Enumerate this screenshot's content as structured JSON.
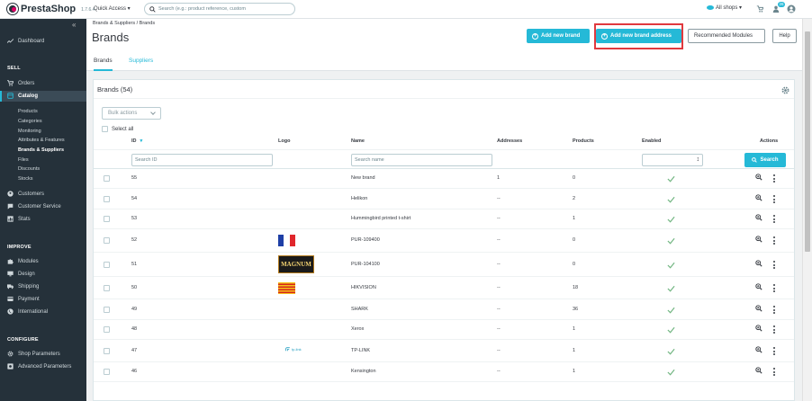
{
  "app": {
    "brand": "PrestaShop",
    "version": "1.7.6.4"
  },
  "topbar": {
    "quick_access": "Quick Access ▾",
    "search_placeholder": "Search (e.g.: product reference, custom",
    "all_shops": "All shops ▾",
    "badge_cart": "",
    "badge_users": "26"
  },
  "sidebar": {
    "dashboard": "Dashboard",
    "sell": "SELL",
    "orders": "Orders",
    "catalog": "Catalog",
    "catalog_items": [
      "Products",
      "Categories",
      "Monitoring",
      "Attributes & Features",
      "Brands & Suppliers",
      "Files",
      "Discounts",
      "Stocks"
    ],
    "customers": "Customers",
    "customer_service": "Customer Service",
    "stats": "Stats",
    "improve": "IMPROVE",
    "modules": "Modules",
    "design": "Design",
    "shipping": "Shipping",
    "payment": "Payment",
    "international": "International",
    "configure": "CONFIGURE",
    "shop_parameters": "Shop Parameters",
    "advanced_parameters": "Advanced Parameters"
  },
  "header": {
    "breadcrumb": "Brands & Suppliers  /  Brands",
    "title": "Brands",
    "add_brand": "Add new brand",
    "add_brand_address": "Add new brand address",
    "recommended_modules": "Recommended Modules",
    "help": "Help",
    "tabs": [
      "Brands",
      "Suppliers"
    ]
  },
  "panel": {
    "title": "Brands (54)",
    "bulk_actions": "Bulk actions",
    "select_all": "Select all",
    "columns": {
      "id": "ID",
      "logo": "Logo",
      "name": "Name",
      "addresses": "Addresses",
      "products": "Products",
      "enabled": "Enabled",
      "actions": "Actions"
    },
    "search_id_placeholder": "Search ID",
    "search_name_placeholder": "Search name",
    "search_button": "Search",
    "rows": [
      {
        "id": "55",
        "name": "New brand",
        "addresses": "1",
        "products": "0"
      },
      {
        "id": "54",
        "name": "Helikon",
        "addresses": "--",
        "products": "2"
      },
      {
        "id": "53",
        "name": "Hummingbird printed t-shirt",
        "addresses": "--",
        "products": "1"
      },
      {
        "id": "52",
        "name": "PUR-109400",
        "addresses": "--",
        "products": "0"
      },
      {
        "id": "51",
        "name": "PUR-104100",
        "addresses": "--",
        "products": "0"
      },
      {
        "id": "50",
        "name": "HIKVISION",
        "addresses": "--",
        "products": "18"
      },
      {
        "id": "49",
        "name": "SHARK",
        "addresses": "--",
        "products": "36"
      },
      {
        "id": "48",
        "name": "Xerox",
        "addresses": "--",
        "products": "1"
      },
      {
        "id": "47",
        "name": "TP-LINK",
        "addresses": "--",
        "products": "1"
      },
      {
        "id": "46",
        "name": "Kensington",
        "addresses": "--",
        "products": "1"
      }
    ],
    "logo_magnum": "MAGNUM",
    "logo_tplink": "tp-link"
  },
  "colors": {
    "accent": "#25b9d7",
    "sidebar": "#25313a",
    "highlight": "#e0393e",
    "enabled_check": "#70b580"
  }
}
